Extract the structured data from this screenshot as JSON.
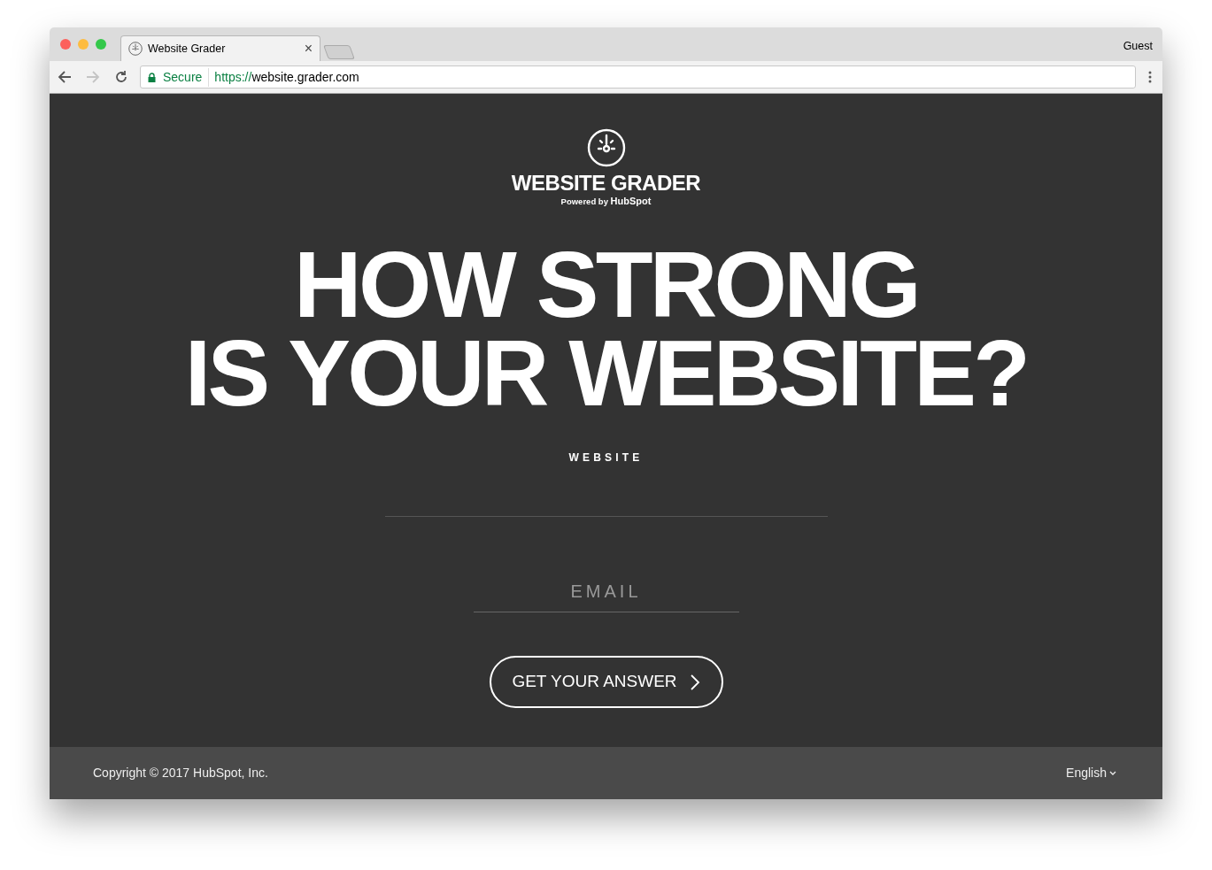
{
  "browser": {
    "tab_title": "Website Grader",
    "tab_close": "×",
    "profile": "Guest",
    "security_label": "Secure",
    "url_scheme": "https://",
    "url_rest": "website.grader.com"
  },
  "brand": {
    "name": "WEBSITE GRADER",
    "powered_by": "Powered by",
    "powered_brand": "HubSpot"
  },
  "headline": [
    "HOW STRONG",
    "IS YOUR WEBSITE?"
  ],
  "website_field": {
    "label": "WEBSITE"
  },
  "email_field": {
    "placeholder": "EMAIL"
  },
  "submit_button": {
    "label": "GET YOUR ANSWER"
  },
  "footer": {
    "copyright": "Copyright © 2017 HubSpot, Inc.",
    "language": "English"
  }
}
